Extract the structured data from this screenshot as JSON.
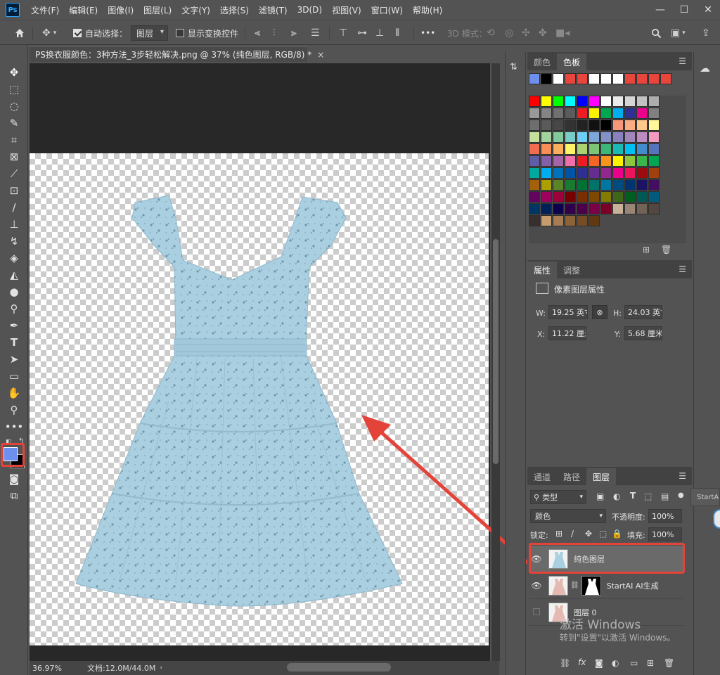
{
  "app": {
    "logo": "Ps"
  },
  "menu": [
    "文件(F)",
    "编辑(E)",
    "图像(I)",
    "图层(L)",
    "文字(Y)",
    "选择(S)",
    "滤镜(T)",
    "3D(D)",
    "视图(V)",
    "窗口(W)",
    "帮助(H)"
  ],
  "options": {
    "auto_select_label": "自动选择：",
    "auto_select_value": "图层",
    "show_transform_label": "显示变换控件",
    "more": "•••",
    "mode_3d_label": "3D 模式："
  },
  "document": {
    "tab_title": "PS换衣服颜色：3种方法_3步轻松解决.png @ 37% (纯色图层, RGB/8) *",
    "close": "×",
    "zoom": "36.97%",
    "doc_size": "文档:12.0M/44.0M"
  },
  "swatches_panel": {
    "tabs": [
      "颜色",
      "色板"
    ],
    "active_tab": "色板",
    "recent": [
      "#6c8ff0",
      "#000000",
      "#ffffff",
      "#e8453c",
      "#e8453c",
      "#ffffff",
      "#ffffff",
      "#ffffff",
      "#e8453c",
      "#e8453c",
      "#e8453c",
      "#e8453c"
    ],
    "grid": [
      [
        "#ff0000",
        "#ffff00",
        "#00ff00",
        "#00ffff",
        "#0000ff",
        "#ff00ff",
        "#ffffff",
        "#ebebeb",
        "#d6d6d6",
        "#c2c2c2",
        "#adadad"
      ],
      [
        "#999999",
        "#858585",
        "#707070",
        "#5c5c5c",
        "#ee1d24",
        "#fff200",
        "#00a650",
        "#00aeef",
        "#2e3192",
        "#ec008c",
        "#808080"
      ],
      [
        "#6e6e6e",
        "#5a5a5a",
        "#474747",
        "#333333",
        "#222222",
        "#111111",
        "#000000",
        "#f7977a",
        "#f9ad81",
        "#fdc68a",
        "#fff79a"
      ],
      [
        "#c4df9b",
        "#a3d39c",
        "#82ca9c",
        "#7accc8",
        "#6dcff6",
        "#7da7d9",
        "#8393ca",
        "#8781bd",
        "#a186be",
        "#bd8cbf",
        "#f49ac1"
      ],
      [
        "#f26c4f",
        "#f68e55",
        "#fbaf5c",
        "#fff467",
        "#acd372",
        "#7cc576",
        "#3bb878",
        "#1abbb4",
        "#00bff3",
        "#438ccb",
        "#5574b9"
      ],
      [
        "#605ca8",
        "#855fa8",
        "#a763a8",
        "#f06ea9",
        "#ed1c24",
        "#f26522",
        "#f7941d",
        "#fff200",
        "#8dc73f",
        "#39b54a",
        "#00a651"
      ],
      [
        "#00a99d",
        "#00aeef",
        "#0072bc",
        "#0054a6",
        "#2e3192",
        "#662d91",
        "#92278f",
        "#ec008c",
        "#ed145b",
        "#9e0b0f",
        "#a0410d"
      ],
      [
        "#a36209",
        "#aba000",
        "#598527",
        "#197b30",
        "#007236",
        "#00746b",
        "#0076a3",
        "#004b80",
        "#003471",
        "#1b1464",
        "#440e62"
      ],
      [
        "#630460",
        "#9e005d",
        "#9e0039",
        "#790000",
        "#7b2e00",
        "#7d4900",
        "#827b00",
        "#406618",
        "#005e20",
        "#005952",
        "#005b7f"
      ],
      [
        "#003663",
        "#002157",
        "#0d004c",
        "#32004b",
        "#4b0049",
        "#7b0046",
        "#7a0026",
        "#c7b299",
        "#998675",
        "#736357",
        "#534741"
      ],
      [
        "#362f2d",
        "#c69c6d",
        "#a67c52",
        "#8c6239",
        "#754c24",
        "#603913"
      ]
    ]
  },
  "properties_panel": {
    "tabs": [
      "属性",
      "调整"
    ],
    "active_tab": "属性",
    "title": "像素图层属性",
    "w_label": "W:",
    "w_value": "19.25 英寸",
    "h_label": "H:",
    "h_value": "24.03 英寸",
    "x_label": "X:",
    "x_value": "11.22 厘米",
    "y_label": "Y:",
    "y_value": "5.68 厘米"
  },
  "layers_panel": {
    "tabs": [
      "通道",
      "路径",
      "图层"
    ],
    "active_tab": "图层",
    "filter_label": "类型",
    "blend_mode": "颜色",
    "opacity_label": "不透明度:",
    "opacity_value": "100%",
    "lock_label": "锁定:",
    "fill_label": "填充:",
    "fill_value": "100%",
    "layers": [
      {
        "name": "纯色图层",
        "visible": true,
        "selected": true
      },
      {
        "name": "StartAI AI生成",
        "visible": true,
        "selected": false
      },
      {
        "name": "图层 0",
        "visible": false,
        "selected": false
      }
    ]
  },
  "flyout_label": "StartA",
  "watermark": {
    "line1": "激活 Windows",
    "line2": "转到\"设置\"以激活 Windows。"
  },
  "colors": {
    "foreground": "#6c8ff0",
    "highlight": "#e4433a",
    "dress": "#a9cfe0"
  }
}
